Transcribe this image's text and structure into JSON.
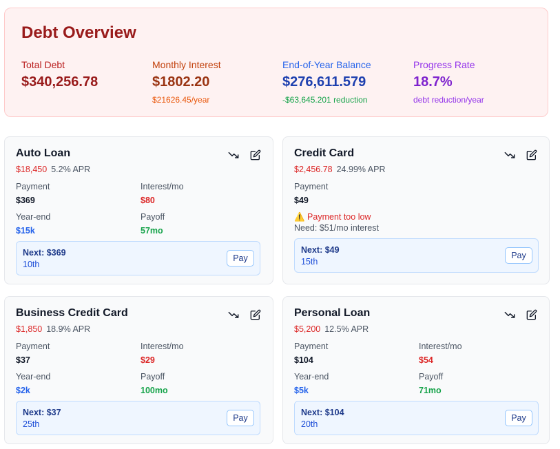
{
  "overview": {
    "title": "Debt Overview",
    "stats": [
      {
        "label": "Total Debt",
        "value": "$340,256.78",
        "sub": ""
      },
      {
        "label": "Monthly Interest",
        "value": "$1802.20",
        "sub": "$21626.45/year"
      },
      {
        "label": "End-of-Year Balance",
        "value": "$276,611.579",
        "sub": "-$63,645.201 reduction"
      },
      {
        "label": "Progress Rate",
        "value": "18.7%",
        "sub": "debt reduction/year"
      }
    ]
  },
  "labels": {
    "payment": "Payment",
    "interest": "Interest/mo",
    "year_end": "Year-end",
    "payoff": "Payoff",
    "pay_button": "Pay"
  },
  "cards": [
    {
      "name": "Auto Loan",
      "balance": "$18,450",
      "apr": "5.2% APR",
      "payment": "$369",
      "interest": "$80",
      "year_end": "$15k",
      "payoff": "57mo",
      "next": "Next: $369",
      "due": "10th"
    },
    {
      "name": "Credit Card",
      "balance": "$2,456.78",
      "apr": "24.99% APR",
      "payment": "$49",
      "warning": "⚠️ Payment too low",
      "warning_detail": "Need: $51/mo interest",
      "next": "Next: $49",
      "due": "15th"
    },
    {
      "name": "Business Credit Card",
      "balance": "$1,850",
      "apr": "18.9% APR",
      "payment": "$37",
      "interest": "$29",
      "year_end": "$2k",
      "payoff": "100mo",
      "next": "Next: $37",
      "due": "25th"
    },
    {
      "name": "Personal Loan",
      "balance": "$5,200",
      "apr": "12.5% APR",
      "payment": "$104",
      "interest": "$54",
      "year_end": "$5k",
      "payoff": "71mo",
      "next": "Next: $104",
      "due": "20th"
    }
  ],
  "icons": {
    "trend": "trending-down-icon",
    "edit": "edit-icon"
  },
  "colors": {
    "overview_title": "#991b1b",
    "total_debt": "#991b1b",
    "monthly_interest": "#c2410c",
    "end_of_year": "#1e40af",
    "progress": "#7e22ce",
    "reduction": "#16a34a",
    "balance": "#dc2626",
    "year_end": "#2563eb",
    "payoff": "#16a34a"
  }
}
